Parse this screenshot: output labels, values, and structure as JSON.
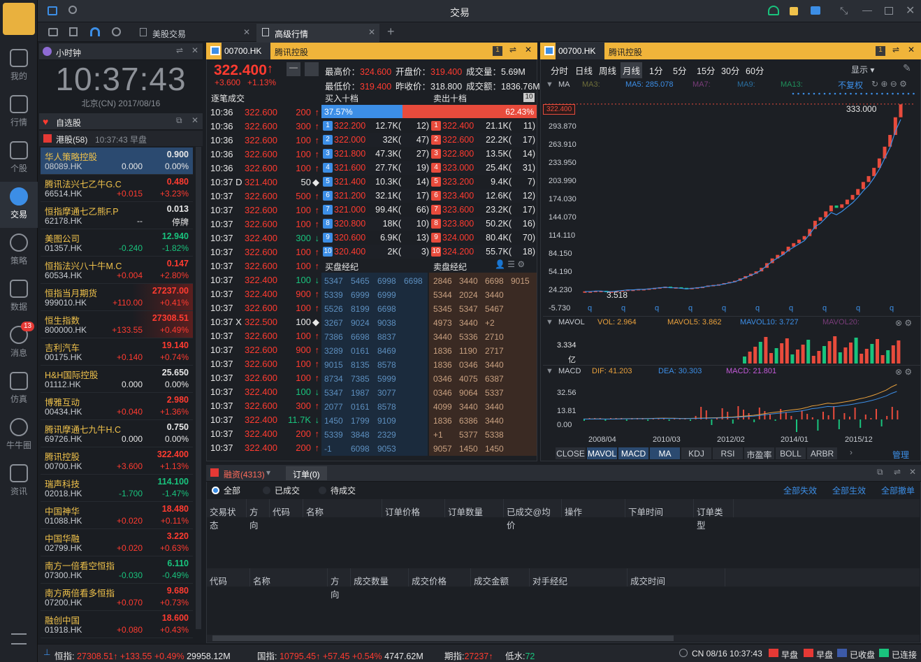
{
  "window": {
    "title": "交易"
  },
  "nav": [
    {
      "label": "我的"
    },
    {
      "label": "行情"
    },
    {
      "label": "个股"
    },
    {
      "label": "交易"
    },
    {
      "label": "策略"
    },
    {
      "label": "数据"
    },
    {
      "label": "消息",
      "badge": "13"
    },
    {
      "label": "仿真"
    },
    {
      "label": "牛牛圈"
    },
    {
      "label": "资讯"
    }
  ],
  "tabs": [
    {
      "label": "美股交易"
    },
    {
      "label": "高级行情"
    }
  ],
  "clock": {
    "title": "小时钟",
    "time": "10:37:43",
    "date": "北京(CN) 2017/08/16"
  },
  "watchlist": {
    "title": "自选股",
    "group": "港股(58)",
    "group_time": "10:37:43 早盘",
    "items": [
      {
        "name": "华人策略控股",
        "code": "08089.HK",
        "price": "0.900",
        "change": "0.000",
        "pct": "0.00%",
        "color": "white"
      },
      {
        "name": "腾讯法兴七乙牛G.C",
        "code": "66514.HK",
        "price": "0.480",
        "change": "+0.015",
        "pct": "+3.23%",
        "color": "red"
      },
      {
        "name": "恒指摩通七乙熊F.P",
        "code": "62178.HK",
        "price": "0.013",
        "change": "--",
        "pct": "停牌",
        "color": "white"
      },
      {
        "name": "美图公司",
        "code": "01357.HK",
        "price": "12.940",
        "change": "-0.240",
        "pct": "-1.82%",
        "color": "green"
      },
      {
        "name": "恒指法兴八十牛M.C",
        "code": "60534.HK",
        "price": "0.147",
        "change": "+0.004",
        "pct": "+2.80%",
        "color": "red"
      },
      {
        "name": "恒指当月期货",
        "code": "999010.HK",
        "price": "27237.00",
        "change": "+110.00",
        "pct": "+0.41%",
        "color": "red"
      },
      {
        "name": "恒生指数",
        "code": "800000.HK",
        "price": "27308.51",
        "change": "+133.55",
        "pct": "+0.49%",
        "color": "red"
      },
      {
        "name": "吉利汽车",
        "code": "00175.HK",
        "price": "19.140",
        "change": "+0.140",
        "pct": "+0.74%",
        "color": "red"
      },
      {
        "name": "H&H国际控股",
        "code": "01112.HK",
        "price": "25.650",
        "change": "0.000",
        "pct": "0.00%",
        "color": "white"
      },
      {
        "name": "博雅互动",
        "code": "00434.HK",
        "price": "2.980",
        "change": "+0.040",
        "pct": "+1.36%",
        "color": "red"
      },
      {
        "name": "腾讯摩通七九牛H.C",
        "code": "69726.HK",
        "price": "0.750",
        "change": "0.000",
        "pct": "0.00%",
        "color": "white"
      },
      {
        "name": "腾讯控股",
        "code": "00700.HK",
        "price": "322.400",
        "change": "+3.600",
        "pct": "+1.13%",
        "color": "red"
      },
      {
        "name": "瑞声科技",
        "code": "02018.HK",
        "price": "114.100",
        "change": "-1.700",
        "pct": "-1.47%",
        "color": "green"
      },
      {
        "name": "中国神华",
        "code": "01088.HK",
        "price": "18.480",
        "change": "+0.020",
        "pct": "+0.11%",
        "color": "red"
      },
      {
        "name": "中国华融",
        "code": "02799.HK",
        "price": "3.220",
        "change": "+0.020",
        "pct": "+0.63%",
        "color": "red"
      },
      {
        "name": "南方一倍看空恒指",
        "code": "07300.HK",
        "price": "6.110",
        "change": "-0.030",
        "pct": "-0.49%",
        "color": "green"
      },
      {
        "name": "南方两倍看多恒指",
        "code": "07200.HK",
        "price": "9.680",
        "change": "+0.070",
        "pct": "+0.73%",
        "color": "red"
      },
      {
        "name": "融创中国",
        "code": "01918.HK",
        "price": "18.600",
        "change": "+0.080",
        "pct": "+0.43%",
        "color": "red"
      }
    ]
  },
  "quote": {
    "code": "00700.HK",
    "name": "腾讯控股",
    "price": "322.400",
    "change": "+3.600",
    "pct": "+1.13%",
    "high_label": "最高价",
    "high": "324.600",
    "low_label": "最低价",
    "low": "319.400",
    "open_label": "开盘价",
    "open": "319.400",
    "prev_label": "昨收价",
    "prev": "318.800",
    "vol_label": "成交量",
    "vol": "5.69M",
    "amt_label": "成交额",
    "amt": "1836.76M"
  },
  "ticks_title": "逐笔成交",
  "bid_title": "买入十档",
  "ask_title": "卖出十档",
  "ten": "10",
  "bid_pct": "37.57%",
  "ask_pct": "62.43%",
  "ticks": [
    [
      "10:36",
      "322.600",
      "200",
      "up"
    ],
    [
      "10:36",
      "322.600",
      "300",
      "up"
    ],
    [
      "10:36",
      "322.600",
      "100",
      "up"
    ],
    [
      "10:36",
      "322.600",
      "100",
      "up"
    ],
    [
      "10:36",
      "322.600",
      "100",
      "up"
    ],
    [
      "10:37 D",
      "321.400",
      "50",
      "dot"
    ],
    [
      "10:37",
      "322.600",
      "500",
      "up"
    ],
    [
      "10:37",
      "322.600",
      "100",
      "up"
    ],
    [
      "10:37",
      "322.600",
      "100",
      "up"
    ],
    [
      "10:37",
      "322.400",
      "300",
      "down"
    ],
    [
      "10:37",
      "322.600",
      "100",
      "up"
    ],
    [
      "10:37",
      "322.600",
      "100",
      "up"
    ],
    [
      "10:37",
      "322.400",
      "100",
      "down"
    ],
    [
      "10:37",
      "322.400",
      "900",
      "up"
    ],
    [
      "10:37",
      "322.600",
      "100",
      "up"
    ],
    [
      "10:37 X",
      "322.500",
      "100",
      "dot"
    ],
    [
      "10:37",
      "322.600",
      "100",
      "up"
    ],
    [
      "10:37",
      "322.600",
      "900",
      "up"
    ],
    [
      "10:37",
      "322.600",
      "100",
      "up"
    ],
    [
      "10:37",
      "322.600",
      "100",
      "up"
    ],
    [
      "10:37",
      "322.400",
      "100",
      "down"
    ],
    [
      "10:37",
      "322.600",
      "300",
      "up"
    ],
    [
      "10:37",
      "322.400",
      "11.7K",
      "down"
    ],
    [
      "10:37",
      "322.400",
      "200",
      "up"
    ],
    [
      "10:37",
      "322.400",
      "200",
      "up"
    ]
  ],
  "bids": [
    [
      "1",
      "322.200",
      "12.7K(",
      "12)"
    ],
    [
      "2",
      "322.000",
      "32K(",
      "47)"
    ],
    [
      "3",
      "321.800",
      "47.3K(",
      "27)"
    ],
    [
      "4",
      "321.600",
      "27.7K(",
      "19)"
    ],
    [
      "5",
      "321.400",
      "10.3K(",
      "14)"
    ],
    [
      "6",
      "321.200",
      "32.1K(",
      "17)"
    ],
    [
      "7",
      "321.000",
      "99.4K(",
      "66)"
    ],
    [
      "8",
      "320.800",
      "18K(",
      "10)"
    ],
    [
      "9",
      "320.600",
      "6.9K(",
      "13)"
    ],
    [
      "10",
      "320.400",
      "2K(",
      "3)"
    ]
  ],
  "asks": [
    [
      "1",
      "322.400",
      "21.1K(",
      "11)"
    ],
    [
      "2",
      "322.600",
      "22.2K(",
      "17)"
    ],
    [
      "3",
      "322.800",
      "13.5K(",
      "14)"
    ],
    [
      "4",
      "323.000",
      "25.4K(",
      "31)"
    ],
    [
      "5",
      "323.200",
      "9.4K(",
      "7)"
    ],
    [
      "6",
      "323.400",
      "12.6K(",
      "12)"
    ],
    [
      "7",
      "323.600",
      "23.2K(",
      "17)"
    ],
    [
      "8",
      "323.800",
      "50.2K(",
      "16)"
    ],
    [
      "9",
      "324.000",
      "80.4K(",
      "70)"
    ],
    [
      "10",
      "324.200",
      "55.7K(",
      "18)"
    ]
  ],
  "buy_broker_title": "买盘经纪",
  "sell_broker_title": "卖盘经纪",
  "buy_brokers": [
    [
      "5347",
      "5465",
      "6998",
      "6698"
    ],
    [
      "5339",
      "6999",
      "6999",
      ""
    ],
    [
      "5526",
      "8199",
      "6698",
      ""
    ],
    [
      "3267",
      "9024",
      "9038",
      ""
    ],
    [
      "7386",
      "6698",
      "8837",
      ""
    ],
    [
      "3289",
      "0161",
      "8469",
      ""
    ],
    [
      "9015",
      "8135",
      "8578",
      ""
    ],
    [
      "8734",
      "7385",
      "5999",
      ""
    ],
    [
      "5347",
      "1987",
      "3077",
      ""
    ],
    [
      "2077",
      "0161",
      "8578",
      ""
    ],
    [
      "1450",
      "1799",
      "9109",
      ""
    ],
    [
      "5339",
      "3848",
      "2329",
      ""
    ],
    [
      "-1",
      "6098",
      "9053",
      ""
    ]
  ],
  "sell_brokers": [
    [
      "2846",
      "3440",
      "6698",
      "9015"
    ],
    [
      "5344",
      "2024",
      "3440",
      ""
    ],
    [
      "5345",
      "5347",
      "5467",
      ""
    ],
    [
      "4973",
      "3440",
      "+2",
      ""
    ],
    [
      "3440",
      "5336",
      "2710",
      ""
    ],
    [
      "1836",
      "1190",
      "2717",
      ""
    ],
    [
      "1836",
      "0346",
      "3440",
      ""
    ],
    [
      "0346",
      "4075",
      "6387",
      ""
    ],
    [
      "0346",
      "9064",
      "5337",
      ""
    ],
    [
      "4099",
      "3440",
      "3440",
      ""
    ],
    [
      "1836",
      "6386",
      "3440",
      ""
    ],
    [
      "+1",
      "5377",
      "5338",
      ""
    ],
    [
      "9057",
      "1450",
      "1450",
      ""
    ]
  ],
  "chart": {
    "periods": [
      "分时",
      "日线",
      "周线",
      "月线",
      "1分",
      "5分",
      "15分",
      "30分",
      "60分"
    ],
    "active": "月线",
    "display": "显示",
    "ma_label": "MA",
    "ma3": "MA3:",
    "ma5": "MA5: 285.078",
    "ma7": "MA7:",
    "ma9": "MA9:",
    "ma13": "MA13:",
    "adj": "不复权",
    "y_labels": [
      "293.870",
      "263.910",
      "233.950",
      "203.990",
      "174.030",
      "144.070",
      "114.110",
      "84.150",
      "54.190",
      "24.230",
      "-5.730"
    ],
    "last_price": "322.400",
    "high_mark": "333.000",
    "low_mark": "3.518",
    "vol_label": "MAVOL",
    "vol_value": "VOL: 2.964",
    "mavol5": "MAVOL5: 3.862",
    "mavol10": "MAVOL10: 3.727",
    "mavol20": "MAVOL20:",
    "vol_y": "3.334",
    "vol_unit": "亿",
    "macd_label": "MACD",
    "dif": "DIF: 41.203",
    "dea": "DEA: 30.303",
    "macd": "MACD: 21.801",
    "macd_y": [
      "32.56",
      "13.81",
      "0.00"
    ],
    "x_labels": [
      "2008/04",
      "2010/03",
      "2012/02",
      "2014/01",
      "2015/12"
    ],
    "indicators": [
      "CLOSE",
      "MAVOL",
      "MACD",
      "MA",
      "KDJ",
      "RSI",
      "市盈率",
      "BOLL",
      "ARBR"
    ],
    "manage": "管理",
    "series": {
      "close": [
        4,
        4,
        5,
        5,
        4,
        4,
        5,
        6,
        7,
        7,
        8,
        8,
        9,
        10,
        11,
        12,
        11,
        11,
        10,
        9,
        10,
        11,
        12,
        14,
        15,
        16,
        18,
        20,
        22,
        26,
        30,
        34,
        38,
        44,
        52,
        60,
        66,
        72,
        80,
        86,
        92,
        98,
        110,
        124,
        130,
        140,
        150,
        146,
        152,
        160,
        168,
        178,
        190,
        200,
        214,
        230,
        250,
        270,
        300,
        322
      ]
    }
  },
  "orders": {
    "account": "融资(4313)",
    "tab": "订单(0)",
    "filters": [
      "全部",
      "已成交",
      "待成交"
    ],
    "actions": [
      "全部失效",
      "全部生效",
      "全部撤单"
    ],
    "cols": [
      "交易状态",
      "方向",
      "代码",
      "名称",
      "订单价格",
      "订单数量",
      "已成交@均价",
      "操作",
      "下单时间",
      "订单类型"
    ],
    "cols2": [
      "代码",
      "名称",
      "方向",
      "成交数量",
      "成交价格",
      "成交金额",
      "对手经纪",
      "成交时间"
    ]
  },
  "status": {
    "hsi_label": "恒指:",
    "hsi": "27308.51",
    "hsi_up": "+133.55",
    "hsi_pct": "+0.49%",
    "hsi_amt": "29958.12M",
    "hsc_label": "国指:",
    "hsc": "10795.45",
    "hsc_up": "+57.45",
    "hsc_pct": "+0.54%",
    "hsc_amt": "4747.62M",
    "fut_label": "期指:",
    "fut": "27237",
    "lowwater_label": "低水:",
    "lowwater": "72",
    "cn_time": "CN 08/16 10:37:43",
    "m1": "早盘",
    "m2": "早盘",
    "m3": "已收盘",
    "m4": "已连接"
  }
}
